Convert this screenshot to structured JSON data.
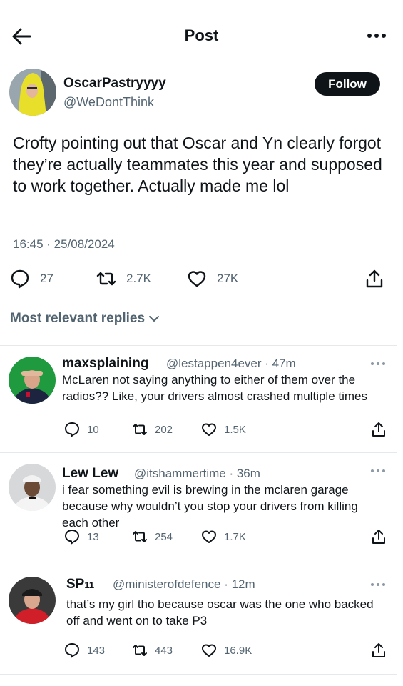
{
  "header": {
    "title": "Post"
  },
  "post": {
    "author_name": "OscarPastryyyy",
    "author_handle": "@WeDontThink",
    "follow_label": "Follow",
    "text": "Crofty pointing out that Oscar and Yn clearly forgot they’re actually teammates this year and supposed to work together. Actually made me lol",
    "timestamp": "16:45 · 25/08/2024",
    "replies": "27",
    "reposts": "2.7K",
    "likes": "27K"
  },
  "sort": {
    "label": "Most relevant replies"
  },
  "replies": [
    {
      "name": "maxsplaining",
      "handle": "@lestappen4ever",
      "time": "· 47m",
      "text": "McLaren not saying anything to either of them over the radios?? Like, your drivers almost crashed multiple times",
      "replies": "10",
      "reposts": "202",
      "likes": "1.5K"
    },
    {
      "name": "Lew Lew",
      "handle": "@itshammertime",
      "time": "· 36m",
      "text": "i fear something evil is brewing in the mclaren garage because why wouldn’t you stop your drivers from killing each other",
      "replies": "13",
      "reposts": "254",
      "likes": "1.7K"
    },
    {
      "name": "SP",
      "name_sub": "11",
      "handle": "@ministerofdefence",
      "time": "· 12m",
      "text": "that’s my girl tho because oscar was the one who backed off and went on to take P3",
      "replies": "143",
      "reposts": "443",
      "likes": "16.9K"
    }
  ]
}
